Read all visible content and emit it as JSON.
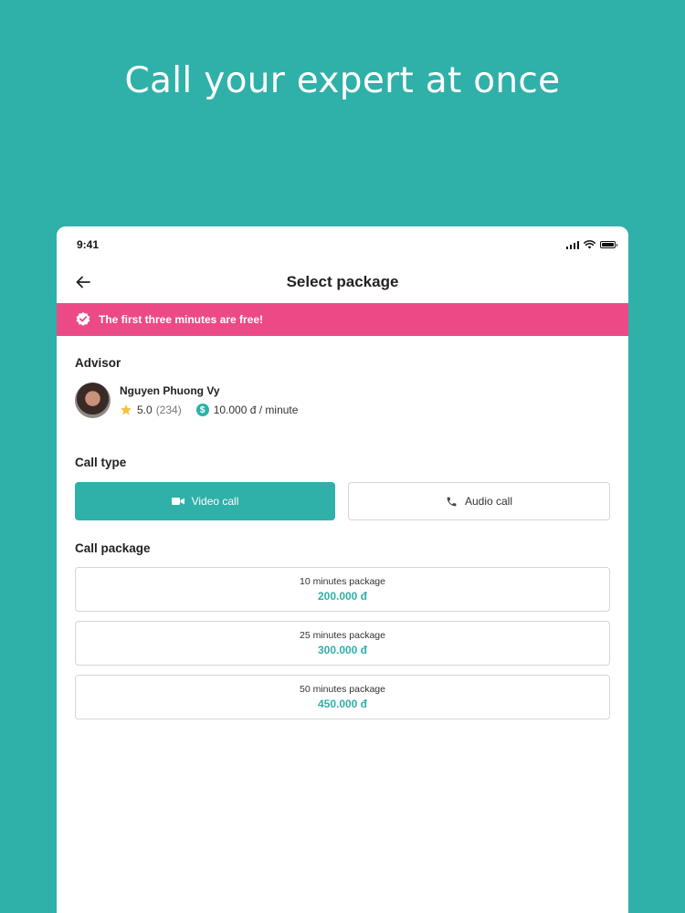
{
  "headline": "Call your expert at once",
  "status_bar": {
    "time": "9:41"
  },
  "nav": {
    "title": "Select package"
  },
  "promo": {
    "text": "The first three minutes are free!"
  },
  "advisor": {
    "section_title": "Advisor",
    "name": "Nguyen Phuong Vy",
    "rating": "5.0",
    "rating_count": "(234)",
    "price": "10.000 đ / minute",
    "price_icon_glyph": "$"
  },
  "call_type": {
    "section_title": "Call type",
    "video_label": "Video call",
    "audio_label": "Audio call",
    "selected": "video"
  },
  "call_package": {
    "section_title": "Call package",
    "packages": [
      {
        "name": "10 minutes package",
        "price": "200.000 đ"
      },
      {
        "name": "25 minutes package",
        "price": "300.000 đ"
      },
      {
        "name": "50 minutes package",
        "price": "450.000 đ"
      }
    ]
  },
  "colors": {
    "background": "#2fb0a9",
    "accent": "#2fb0a9",
    "promo": "#ec4a86",
    "star": "#f5c242"
  },
  "icons": [
    "arrow-left-icon",
    "verified-badge-icon",
    "star-icon",
    "dollar-icon",
    "video-camera-icon",
    "phone-icon",
    "signal-icon",
    "wifi-icon",
    "battery-icon"
  ]
}
